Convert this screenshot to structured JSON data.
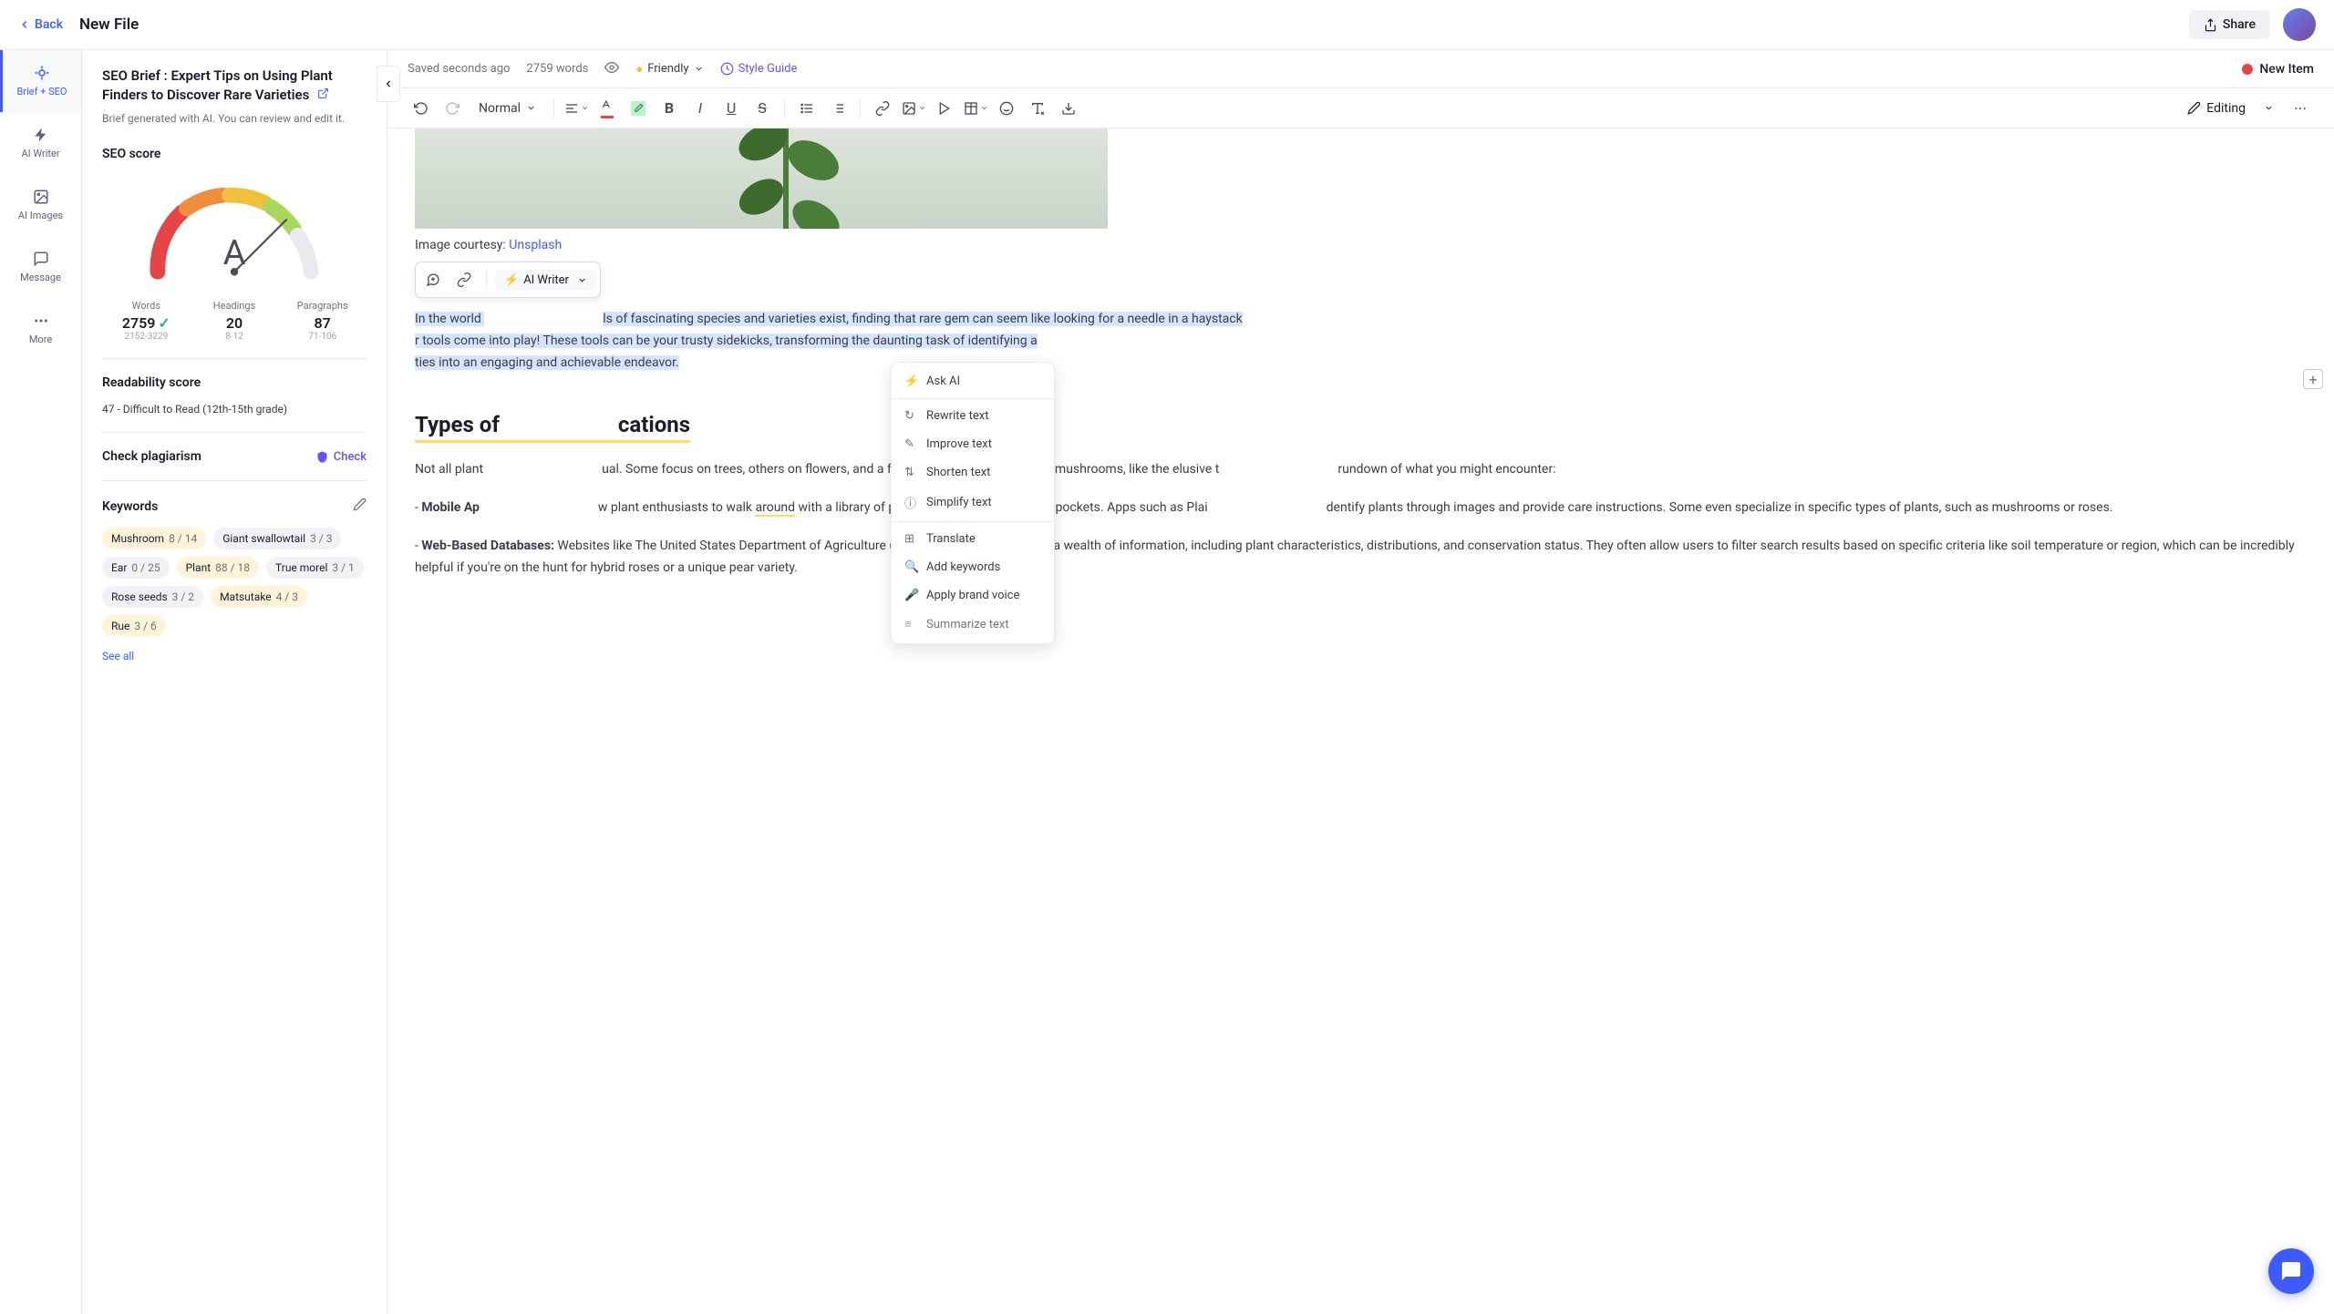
{
  "topBar": {
    "back": "Back",
    "fileName": "New File",
    "share": "Share"
  },
  "leftNav": [
    {
      "label": "Brief + SEO"
    },
    {
      "label": "AI Writer"
    },
    {
      "label": "AI Images"
    },
    {
      "label": "Message"
    },
    {
      "label": "More"
    }
  ],
  "brief": {
    "title": "SEO Brief : Expert Tips on Using Plant Finders to Discover Rare Varieties",
    "desc": "Brief generated with AI. You can review and edit it."
  },
  "seo": {
    "title": "SEO score",
    "grade": "A",
    "stats": {
      "words": {
        "label": "Words",
        "value": "2759",
        "range": "2152-3229"
      },
      "headings": {
        "label": "Headings",
        "value": "20",
        "range": "8-12"
      },
      "paragraphs": {
        "label": "Paragraphs",
        "value": "87",
        "range": "71-106"
      }
    }
  },
  "readability": {
    "title": "Readability score",
    "text": "47 - Difficult to Read (12th-15th grade)"
  },
  "plagiarism": {
    "title": "Check plagiarism",
    "action": "Check"
  },
  "keywords": {
    "title": "Keywords",
    "items": [
      {
        "name": "Mushroom",
        "count": "8 / 14",
        "warn": true
      },
      {
        "name": "Giant swallowtail",
        "count": "3 / 3",
        "warn": false
      },
      {
        "name": "Ear",
        "count": "0 / 25",
        "warn": false
      },
      {
        "name": "Plant",
        "count": "88 / 18",
        "warn": true
      },
      {
        "name": "True morel",
        "count": "3 / 1",
        "warn": false
      },
      {
        "name": "Rose seeds",
        "count": "3 / 2",
        "warn": false
      },
      {
        "name": "Matsutake",
        "count": "4 / 3",
        "warn": true
      },
      {
        "name": "Rue",
        "count": "3 / 6",
        "warn": true
      }
    ],
    "seeAll": "See all"
  },
  "editorHeader": {
    "saved": "Saved seconds ago",
    "words": "2759 words",
    "tone": "Friendly",
    "styleGuide": "Style Guide",
    "newItem": "New Item"
  },
  "toolbar": {
    "normal": "Normal",
    "editing": "Editing"
  },
  "content": {
    "imgCaption": "Image courtesy: ",
    "imgSource": "Unsplash",
    "aiWriter": "AI Writer",
    "para1a": "In the world ",
    "para1b": "ls of fascinating species and varieties exist, finding that rare gem can seem like looking for a needle in a haystack",
    "para1c": "r tools come into play! These tools can be your trusty sidekicks, transforming the daunting task of identifying a",
    "para1d": "ties into an engaging and achievable endeavor.",
    "h2": "Types of",
    "h2b": "cations",
    "para2": "Not all plant",
    "para2b": "ual. Some focus on trees, others on flowers, and a few are tailored to identifying mushrooms, like the elusive t",
    "para2c": "rundown of what you might encounter:",
    "bullet1a": "- ",
    "bullet1b": "Mobile Ap",
    "bullet1c": "w plant enthusiasts to walk ",
    "bullet1d": "around",
    "bullet1e": " with a library of plant knowledge right in their pockets. Apps such as Plai",
    "bullet1f": "dentify plants through images and provide care instructions. Some even specialize in specific types of plants, such as mushrooms or roses.",
    "bullet2a": "- ",
    "bullet2b": "Web-Based Databases:",
    "bullet2c": " Websites like The United States Department of Agriculture (USDA) Plant Database offer a wealth of information, including plant characteristics, distributions, and conservation status. They often allow users to filter search results based on specific criteria like soil temperature or region, which can be incredibly helpful if you're on the hunt for hybrid roses or a unique pear variety."
  },
  "dropdown": [
    "Ask AI",
    "Rewrite text",
    "Improve text",
    "Shorten text",
    "Simplify text",
    "Translate",
    "Add keywords",
    "Apply brand voice",
    "Summarize text"
  ]
}
